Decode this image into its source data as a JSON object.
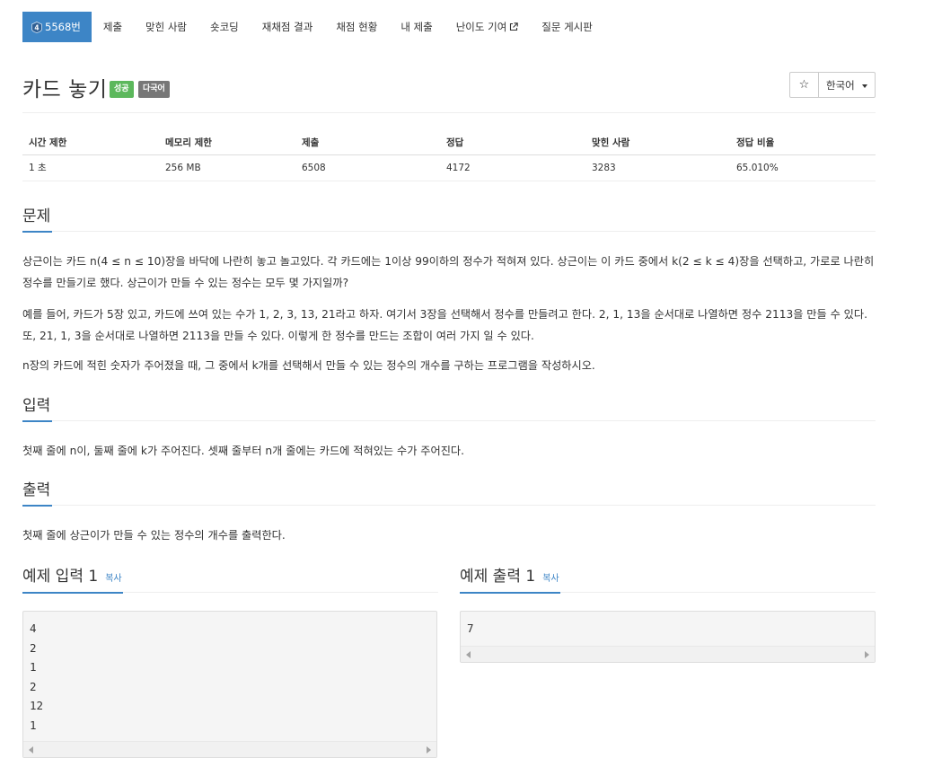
{
  "nav": {
    "items": [
      {
        "label": "5568번",
        "active": true
      },
      {
        "label": "제출"
      },
      {
        "label": "맞힌 사람"
      },
      {
        "label": "숏코딩"
      },
      {
        "label": "재채점 결과"
      },
      {
        "label": "채점 현황"
      },
      {
        "label": "내 제출"
      },
      {
        "label": "난이도 기여"
      },
      {
        "label": "질문 게시판"
      }
    ],
    "tier_badge": "4"
  },
  "header": {
    "title": "카드 놓기",
    "badge_success": "성공",
    "badge_lang": "다국어",
    "star": "☆",
    "language": "한국어"
  },
  "info": {
    "headers": [
      "시간 제한",
      "메모리 제한",
      "제출",
      "정답",
      "맞힌 사람",
      "정답 비율"
    ],
    "values": [
      "1 초",
      "256 MB",
      "6508",
      "4172",
      "3283",
      "65.010%"
    ]
  },
  "problem": {
    "heading": "문제",
    "p1": "상근이는 카드 n(4 ≤ n ≤ 10)장을 바닥에 나란히 놓고 놀고있다. 각 카드에는 1이상 99이하의 정수가 적혀져 있다. 상근이는 이 카드 중에서 k(2 ≤ k ≤ 4)장을 선택하고, 가로로 나란히 정수를 만들기로 했다. 상근이가 만들 수 있는 정수는 모두 몇 가지일까?",
    "p2": "예를 들어, 카드가 5장 있고, 카드에 쓰여 있는 수가 1, 2, 3, 13, 21라고 하자. 여기서 3장을 선택해서 정수를 만들려고 한다. 2, 1, 13을 순서대로 나열하면 정수 2113을 만들 수 있다. 또, 21, 1, 3을 순서대로 나열하면 2113을 만들 수 있다. 이렇게 한 정수를 만드는 조합이 여러 가지 일 수 있다.",
    "p3": "n장의 카드에 적힌 숫자가 주어졌을 때, 그 중에서 k개를 선택해서 만들 수 있는 정수의 개수를 구하는 프로그램을 작성하시오."
  },
  "input": {
    "heading": "입력",
    "text": "첫째 줄에 n이, 둘째 줄에 k가 주어진다. 셋째 줄부터 n개 줄에는 카드에 적혀있는 수가 주어진다."
  },
  "output": {
    "heading": "출력",
    "text": "첫째 줄에 상근이가 만들 수 있는 정수의 개수를 출력한다."
  },
  "samples": {
    "input_heading": "예제 입력 1",
    "output_heading": "예제 출력 1",
    "copy_label": "복사",
    "input_lines": [
      "4",
      "2",
      "1",
      "2",
      "12",
      "1"
    ],
    "output_lines": [
      "7"
    ]
  },
  "colors": {
    "accent": "#3d85c6",
    "success": "#5cb85c",
    "lang_badge": "#777777"
  }
}
